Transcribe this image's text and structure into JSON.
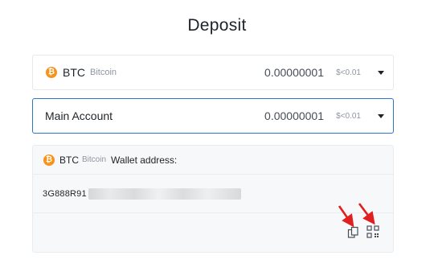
{
  "page": {
    "title": "Deposit"
  },
  "coin_select": {
    "symbol": "BTC",
    "name": "Bitcoin",
    "amount": "0.00000001",
    "usd": "$<0.01",
    "icon_glyph": "₿"
  },
  "account_select": {
    "label": "Main Account",
    "amount": "0.00000001",
    "usd": "$<0.01"
  },
  "wallet": {
    "symbol": "BTC",
    "name": "Bitcoin",
    "label": "Wallet address:",
    "address_prefix": "3G888R91",
    "icon_glyph": "₿"
  },
  "colors": {
    "btc": "#f7931a",
    "focus_border": "#2c76c9",
    "annotation_arrow": "#e02020"
  },
  "icons": {
    "copy": "copy-icon",
    "qr": "qr-code-icon",
    "dropdown": "chevron-down-icon"
  }
}
